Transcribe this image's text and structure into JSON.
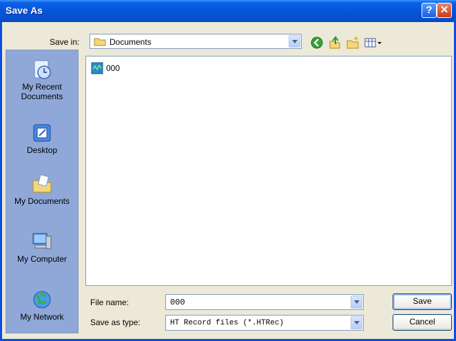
{
  "window": {
    "title": "Save As"
  },
  "toolbar": {
    "save_in_label": "Save in:",
    "save_in_value": "Documents",
    "back_icon": "back-arrow-icon",
    "up_icon": "up-folder-icon",
    "new_folder_icon": "new-folder-icon",
    "views_icon": "views-menu-icon"
  },
  "places": [
    {
      "label_line1": "My Recent",
      "label_line2": "Documents",
      "icon": "recent-documents-icon"
    },
    {
      "label_line1": "Desktop",
      "label_line2": "",
      "icon": "desktop-icon"
    },
    {
      "label_line1": "My Documents",
      "label_line2": "",
      "icon": "my-documents-icon"
    },
    {
      "label_line1": "My Computer",
      "label_line2": "",
      "icon": "my-computer-icon"
    },
    {
      "label_line1": "My Network",
      "label_line2": "",
      "icon": "my-network-icon"
    }
  ],
  "files": [
    {
      "name": "000",
      "icon": "record-file-icon"
    }
  ],
  "form": {
    "file_name_label": "File name:",
    "file_name_value": "000",
    "save_type_label": "Save as type:",
    "save_type_value": "HT Record files (*.HTRec)"
  },
  "buttons": {
    "save": "Save",
    "cancel": "Cancel"
  }
}
